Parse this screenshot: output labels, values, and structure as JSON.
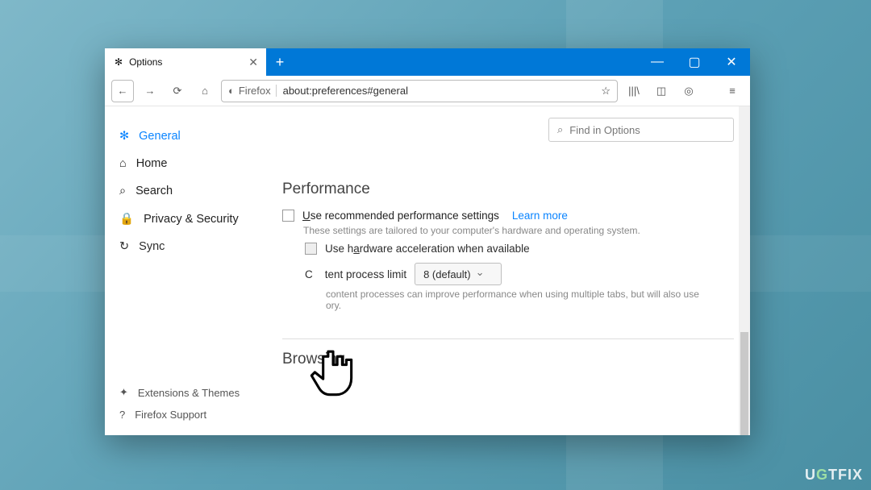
{
  "window": {
    "tab_label": "Options",
    "tab_icon": "gear-icon",
    "new_tab_glyph": "+",
    "controls": {
      "min": "—",
      "max": "▢",
      "close": "✕"
    }
  },
  "navbar": {
    "back": "←",
    "forward": "→",
    "reload": "⟳",
    "home": "⌂",
    "firefox_prefix": "Firefox",
    "url": "about:preferences#general",
    "star": "☆",
    "library": "|||\\",
    "sidebar": "◫",
    "account": "◎",
    "menu": "≡"
  },
  "search": {
    "icon": "⌕",
    "placeholder": "Find in Options"
  },
  "sidebar": {
    "items": [
      {
        "icon": "✻",
        "label": "General",
        "active": true
      },
      {
        "icon": "⌂",
        "label": "Home"
      },
      {
        "icon": "⌕",
        "label": "Search"
      },
      {
        "icon": "🔒",
        "label": "Privacy & Security"
      },
      {
        "icon": "↻",
        "label": "Sync"
      }
    ],
    "footer": [
      {
        "icon": "✦",
        "label": "Extensions & Themes"
      },
      {
        "icon": "?",
        "label": "Firefox Support"
      }
    ]
  },
  "performance": {
    "title": "Performance",
    "recommended_pre": "U",
    "recommended_rest": "se recommended performance settings",
    "learn_more": "Learn more",
    "hint1": "These settings are tailored to your computer's hardware and operating system.",
    "hw_pre": "Use h",
    "hw_under": "a",
    "hw_rest": "rdware acceleration when available",
    "limit_pre": "C",
    "limit_rest": "tent process limit",
    "select_value": "8 (default)",
    "hint2": "content processes can improve performance when using multiple tabs, but will also use",
    "hint2b": "ory."
  },
  "browsing": {
    "title": "Browsing"
  },
  "watermark": {
    "left": "U",
    "accent": "G",
    "right": "TFIX"
  }
}
